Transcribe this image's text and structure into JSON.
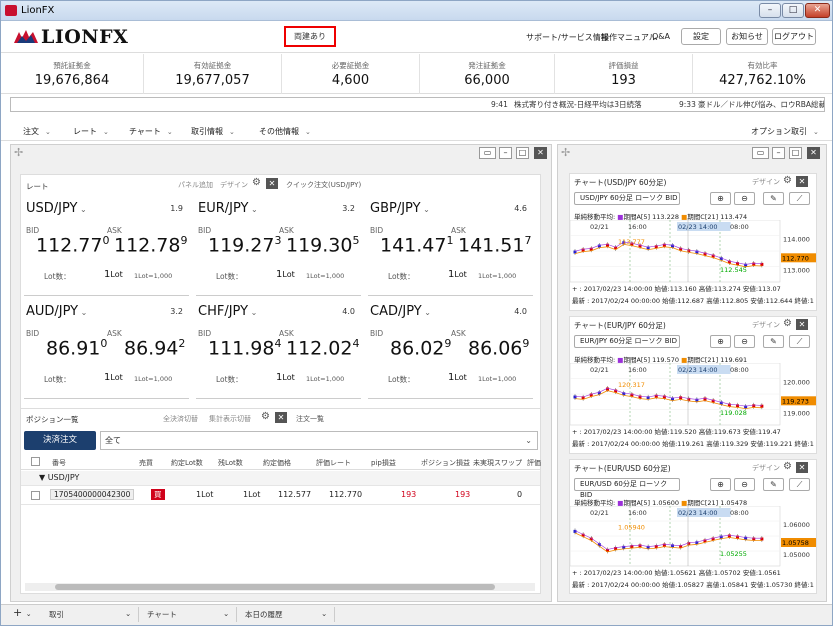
{
  "window": {
    "title": "LionFX"
  },
  "header": {
    "logo_text": "LIONFX",
    "both_ways": "両建あり",
    "links": [
      "サポート/サービス情報",
      "操作マニュアル",
      "Q&A"
    ],
    "buttons": [
      "設定",
      "お知らせ",
      "ログアウト"
    ]
  },
  "summary": [
    {
      "label": "預託証拠金",
      "value": "19,676,864"
    },
    {
      "label": "有効証拠金",
      "value": "19,677,057"
    },
    {
      "label": "必要証拠金",
      "value": "4,600"
    },
    {
      "label": "発注証拠金",
      "value": "66,000"
    },
    {
      "label": "評価損益",
      "value": "193"
    },
    {
      "label": "有効比率",
      "value": "427,762.10%"
    }
  ],
  "ticker": [
    {
      "time": "9:41",
      "text": "株式寄り付き概況-日経平均は3日続落"
    },
    {
      "time": "9:33",
      "text": "豪ドル／ドル伸び悩み、ロウRBA総裁の豪ドル"
    }
  ],
  "menu": {
    "items": [
      "注文",
      "レート",
      "チャート",
      "取引情報",
      "その他情報"
    ],
    "right": "オプション取引"
  },
  "rate_panel": {
    "title": "レート",
    "panel_add": "パネル追加",
    "design": "デザイン",
    "quick": "クイック注文(USD/JPY)",
    "bid_label": "BID",
    "ask_label": "ASK",
    "lot_label": "Lot数：",
    "lot_unit": "1Lot=1,000",
    "rates": [
      {
        "pair": "USD/JPY",
        "spread": "1.9",
        "bid": "112.77",
        "bid_sup": "0",
        "ask": "112.78",
        "ask_sup": "9",
        "lot": "1",
        "lot_suffix": "Lot"
      },
      {
        "pair": "EUR/JPY",
        "spread": "3.2",
        "bid": "119.27",
        "bid_sup": "3",
        "ask": "119.30",
        "ask_sup": "5",
        "lot": "1",
        "lot_suffix": "Lot"
      },
      {
        "pair": "GBP/JPY",
        "spread": "4.6",
        "bid": "141.47",
        "bid_sup": "1",
        "ask": "141.51",
        "ask_sup": "7",
        "lot": "1",
        "lot_suffix": "Lot"
      },
      {
        "pair": "AUD/JPY",
        "spread": "3.2",
        "bid": "86.91",
        "bid_sup": "0",
        "ask": "86.94",
        "ask_sup": "2",
        "lot": "1",
        "lot_suffix": "Lot"
      },
      {
        "pair": "CHF/JPY",
        "spread": "4.0",
        "bid": "111.98",
        "bid_sup": "4",
        "ask": "112.02",
        "ask_sup": "4",
        "lot": "1",
        "lot_suffix": "Lot"
      },
      {
        "pair": "CAD/JPY",
        "spread": "4.0",
        "bid": "86.02",
        "bid_sup": "9",
        "ask": "86.06",
        "ask_sup": "9",
        "lot": "1",
        "lot_suffix": "Lot"
      }
    ]
  },
  "positions": {
    "title": "ポジション一覧",
    "bulk_close": "全決済切替",
    "aggregate": "集計表示切替",
    "orders_tab": "注文一覧",
    "settle_btn": "決済注文",
    "filter": "全て",
    "columns": [
      "番号",
      "売買",
      "約定Lot数",
      "残Lot数",
      "約定価格",
      "評価レート",
      "pip損益",
      "ポジション損益",
      "未実現スワップ",
      "評価"
    ],
    "group": "USD/JPY",
    "rows": [
      {
        "id": "1705400000042300",
        "side": "買",
        "lots": "1Lot",
        "remain": "1Lot",
        "price": "112.577",
        "rate": "112.770",
        "pips": "193",
        "pl": "193",
        "swap": "0"
      }
    ]
  },
  "charts": [
    {
      "title": "チャート(USD/JPY 60分足)",
      "design": "デザイン",
      "select": "USD/JPY 60分足 ローソク BID",
      "legend_label": "単純移動平均:",
      "ma5": "期間A[5] 113.228",
      "ma21": "期間C[21] 113.474",
      "dates": [
        "02/21",
        "16:00",
        "02/23 14:00",
        "08:00"
      ],
      "y_labels": [
        "114.000",
        "113.000"
      ],
      "price_tag": "112.770",
      "hi_label": "113.777",
      "lo_label": "112.545",
      "foot1": "+ : 2017/02/23 14:00:00 始値:113.160 高値:113.274 安値:113.07",
      "foot2": "最新 : 2017/02/24 00:00:00 始値:112.687 高値:112.805 安値:112.644 終値:1"
    },
    {
      "title": "チャート(EUR/JPY 60分足)",
      "design": "デザイン",
      "select": "EUR/JPY 60分足 ローソク BID",
      "legend_label": "単純移動平均:",
      "ma5": "期間A[5] 119.570",
      "ma21": "期間C[21] 119.691",
      "dates": [
        "02/21",
        "16:00",
        "02/23 14:00",
        "08:00"
      ],
      "y_labels": [
        "120.000",
        "119.000"
      ],
      "price_tag": "119.273",
      "hi_label": "120.317",
      "lo_label": "119.028",
      "foot1": "+ : 2017/02/23 14:00:00 始値:119.520 高値:119.673 安値:119.47",
      "foot2": "最新 : 2017/02/24 00:00:00 始値:119.261 高値:119.329 安値:119.221 終値:1"
    },
    {
      "title": "チャート(EUR/USD 60分足)",
      "design": "デザイン",
      "select": "EUR/USD 60分足 ローソク BID",
      "legend_label": "単純移動平均:",
      "ma5": "期間A[5] 1.05600",
      "ma21": "期間C[21] 1.05478",
      "dates": [
        "02/21",
        "16:00",
        "02/23 14:00",
        "08:00"
      ],
      "y_labels": [
        "1.06000",
        "1.05000"
      ],
      "price_tag": "1.05758",
      "hi_label": "1.05940",
      "lo_label": "1.05255",
      "foot1": "+ : 2017/02/23 14:00:00 始値:1.05621 高値:1.05702 安値:1.0561",
      "foot2": "最新 : 2017/02/24 00:00:00 始値:1.05827 高値:1.05841 安値:1.05730 終値:1"
    }
  ],
  "bottom_tabs": [
    "取引",
    "チャート",
    "本日の履歴"
  ]
}
